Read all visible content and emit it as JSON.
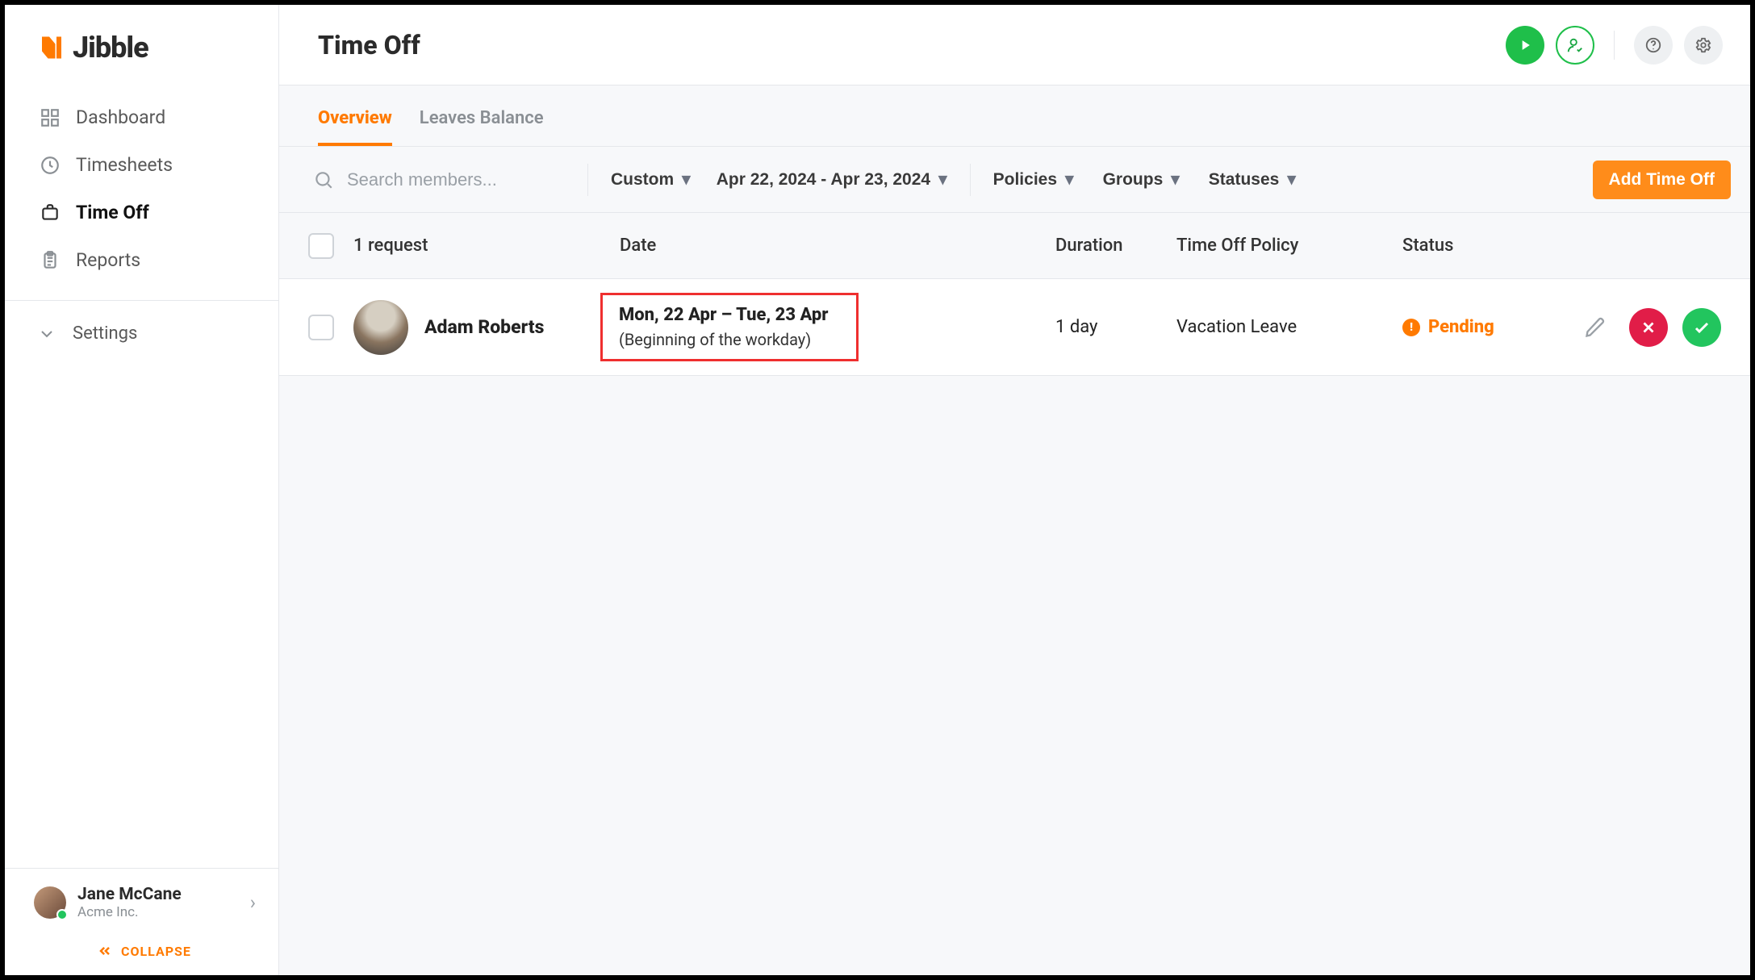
{
  "brand": {
    "name": "Jibble"
  },
  "sidebar": {
    "items": [
      {
        "label": "Dashboard"
      },
      {
        "label": "Timesheets"
      },
      {
        "label": "Time Off"
      },
      {
        "label": "Reports"
      }
    ],
    "settings_label": "Settings",
    "collapse_label": "COLLAPSE"
  },
  "user": {
    "name": "Jane McCane",
    "org": "Acme Inc."
  },
  "page": {
    "title": "Time Off"
  },
  "topbar": {
    "play_tooltip": "Clock In",
    "user_check_tooltip": "Approve",
    "help_tooltip": "Help",
    "settings_tooltip": "Settings"
  },
  "tabs": [
    {
      "label": "Overview",
      "active": true
    },
    {
      "label": "Leaves Balance",
      "active": false
    }
  ],
  "filters": {
    "search_placeholder": "Search members...",
    "range_type": "Custom",
    "date_range": "Apr 22, 2024 - Apr 23, 2024",
    "policies_label": "Policies",
    "groups_label": "Groups",
    "statuses_label": "Statuses",
    "add_button": "Add Time Off"
  },
  "table": {
    "request_count_label": "1 request",
    "headers": {
      "date": "Date",
      "duration": "Duration",
      "policy": "Time Off Policy",
      "status": "Status"
    },
    "rows": [
      {
        "member": "Adam Roberts",
        "date_line1": "Mon, 22 Apr – Tue, 23 Apr",
        "date_line2": "(Beginning of the workday)",
        "duration": "1 day",
        "policy": "Vacation Leave",
        "status": "Pending"
      }
    ]
  }
}
